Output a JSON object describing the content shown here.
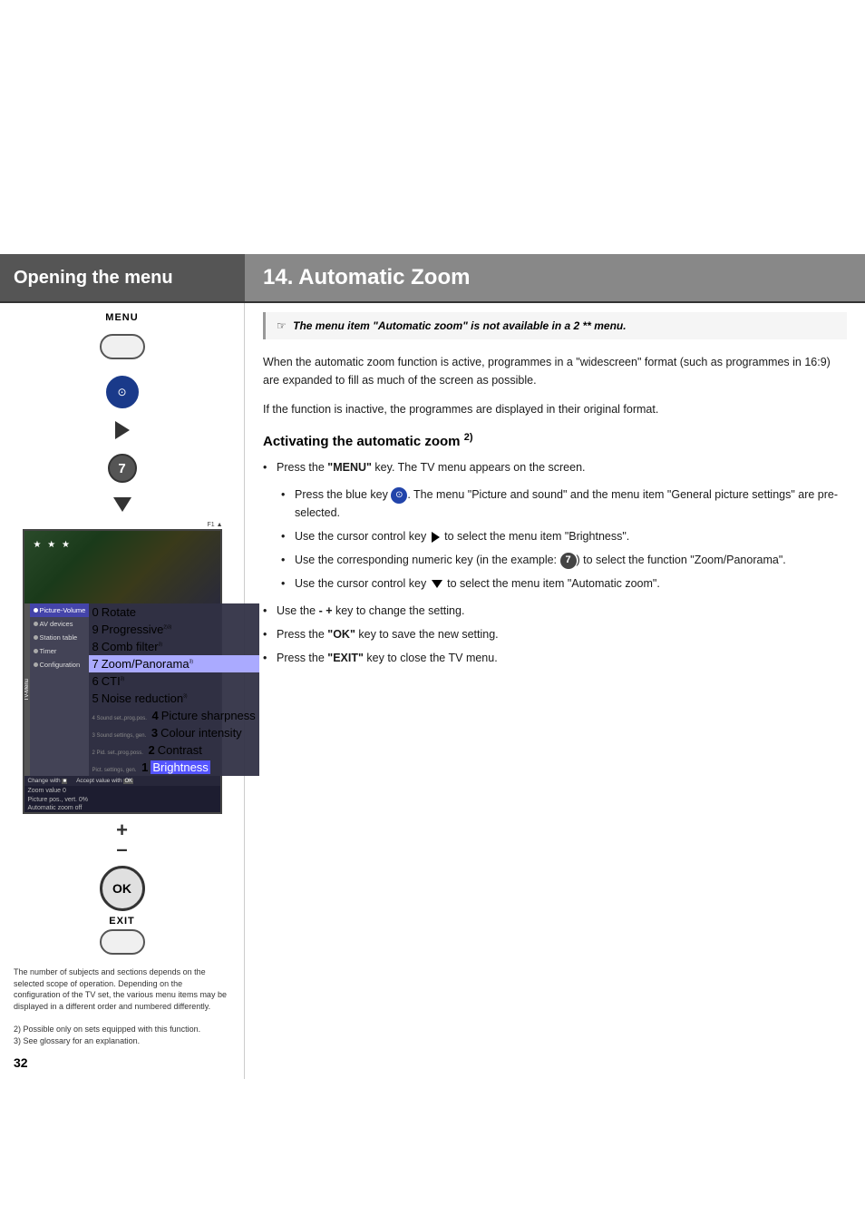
{
  "page": {
    "number": "32",
    "top_white_height": 280
  },
  "header": {
    "left_title": "Opening the menu",
    "right_title": "14. Automatic Zoom"
  },
  "note": {
    "icon": "☞",
    "text": "The menu item \"Automatic zoom\" is not available in a 2 ** menu."
  },
  "body_paragraphs": [
    "When the automatic zoom function is active, programmes in a \"widescreen\" format (such as programmes in 16:9) are expanded to fill as much of the screen as possible.",
    "If the function is inactive, the programmes are displayed in their original format."
  ],
  "subsection": {
    "title": "Activating the automatic zoom",
    "footnote": "2)"
  },
  "steps": [
    {
      "text": "Press the \"MENU\" key. The TV menu appears on the screen."
    }
  ],
  "indented_steps": [
    {
      "text": "Press the blue key ⊙. The menu \"Picture and sound\" and the menu item \"General picture settings\" are pre-selected."
    },
    {
      "text": "Use the cursor control key ▶ to select the menu item \"Brightness\"."
    },
    {
      "text": "Use the corresponding numeric key (in the example: 7) to select the function \"Zoom/Panorama\"."
    },
    {
      "text": "Use the cursor control key ▼ to select the menu item \"Automatic zoom\"."
    }
  ],
  "final_steps": [
    "Use the - + key to change the setting.",
    "Press the \"OK\" key to save the new setting.",
    "Press the \"EXIT\" key to close the TV menu."
  ],
  "remote": {
    "menu_label": "MENU",
    "ok_label": "OK",
    "exit_label": "EXIT",
    "number": "7"
  },
  "tv_menu": {
    "sidebar_items": [
      {
        "label": "Picture-Volume",
        "active": false
      },
      {
        "label": "AV devices",
        "active": false
      },
      {
        "label": "Station table",
        "active": false
      },
      {
        "label": "Timer",
        "active": false
      },
      {
        "label": "Configuration",
        "active": false
      }
    ],
    "right_items": [
      {
        "num": "0",
        "label": "Rotate"
      },
      {
        "num": "9",
        "label": "Progressive"
      },
      {
        "num": "8",
        "label": "Comb filter"
      },
      {
        "num": "7",
        "label": "Zoom/Panorama",
        "highlight": true
      },
      {
        "num": "6",
        "label": "CTI"
      },
      {
        "num": "5",
        "label": "Noise reduction"
      },
      {
        "num": "4",
        "label": "Picture sharpness"
      },
      {
        "num": "3",
        "label": "Colour intensity"
      },
      {
        "num": "2",
        "label": "Contrast"
      },
      {
        "num": "1",
        "label": "Brightness",
        "highlight": false
      }
    ],
    "zoom_value": "Zoom value    0",
    "picture_pos": "Picture pos., vert. 0%",
    "auto_zoom": "Automatic zoom   off"
  },
  "left_footer": {
    "note1": "The number of subjects and sections depends on the selected scope of operation. Depending on the configuration of the TV set, the various menu items may be displayed in a different order and numbered differently.",
    "note2": "2) Possible only on sets equipped with this function.",
    "note3": "3) See glossary for an explanation."
  }
}
